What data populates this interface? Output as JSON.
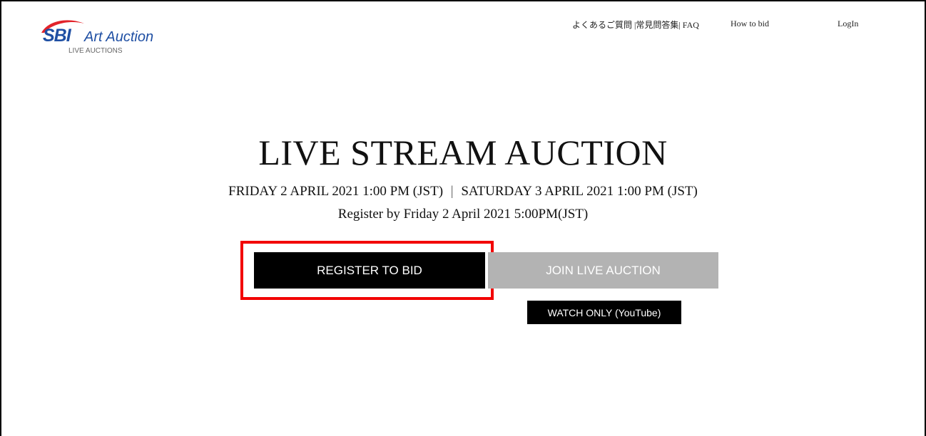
{
  "brand": {
    "sbi": "SBI",
    "name": "Art Auction",
    "subtitle": "LIVE AUCTIONS",
    "swoosh_color": "#e2232a",
    "text_color": "#1f4fa3"
  },
  "nav": {
    "faq": "よくあるご質問 |常見問答集| FAQ",
    "how_to_bid": "How to bid",
    "login": "LogIn"
  },
  "hero": {
    "title": "LIVE STREAM AUCTION",
    "date_1": "FRIDAY 2 APRIL 2021 1:00 PM (JST)",
    "separator": "|",
    "date_2": "SATURDAY 3 APRIL 2021 1:00 PM (JST)",
    "register_by": "Register by Friday 2 April 2021 5:00PM(JST)"
  },
  "buttons": {
    "register": "REGISTER TO BID",
    "join": "JOIN LIVE AUCTION",
    "watch": "WATCH ONLY (YouTube)"
  },
  "colors": {
    "highlight": "#f20000",
    "primary_button": "#000000",
    "disabled_button": "#b3b3b3"
  }
}
